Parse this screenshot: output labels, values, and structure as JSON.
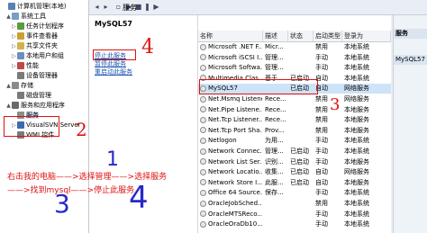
{
  "tree": {
    "items": [
      {
        "label": "计算机管理(本地)",
        "level": 0,
        "expander": "",
        "color": "#5a7fb5"
      },
      {
        "label": "系统工具",
        "level": 1,
        "expander": "▲",
        "color": "#7a9cc9"
      },
      {
        "label": "任务计划程序",
        "level": 2,
        "expander": "▷",
        "color": "#5b9b3e"
      },
      {
        "label": "事件查看器",
        "level": 2,
        "expander": "▷",
        "color": "#c9a036"
      },
      {
        "label": "共享文件夹",
        "level": 2,
        "expander": "▷",
        "color": "#d2b24c"
      },
      {
        "label": "本地用户和组",
        "level": 2,
        "expander": "▷",
        "color": "#6c8ec0"
      },
      {
        "label": "性能",
        "level": 2,
        "expander": "▷",
        "color": "#c04848"
      },
      {
        "label": "设备管理器",
        "level": 2,
        "expander": "",
        "color": "#7a7a7a"
      },
      {
        "label": "存储",
        "level": 1,
        "expander": "▲",
        "color": "#8a8a8a"
      },
      {
        "label": "磁盘管理",
        "level": 2,
        "expander": "",
        "color": "#7a7a7a"
      },
      {
        "label": "服务和应用程序",
        "level": 1,
        "expander": "▲",
        "color": "#6a6a6a"
      },
      {
        "label": "服务",
        "level": 2,
        "expander": "",
        "color": "#8d8d8d"
      },
      {
        "label": "VisualSVN Server",
        "level": 2,
        "expander": "▷",
        "color": "#3a6db0"
      },
      {
        "label": "WMI 控件",
        "level": 2,
        "expander": "",
        "color": "#7a7a7a"
      }
    ]
  },
  "header": {
    "pane_title": "服务",
    "right_pane_title": "服务"
  },
  "detail": {
    "service_name": "MySQL57",
    "links": [
      "停止此服务",
      "暂停此服务",
      "重启动此服务"
    ]
  },
  "list": {
    "columns": [
      "名称",
      "描述",
      "状态",
      "启动类型",
      "登录为"
    ],
    "rows": [
      {
        "name": "Microsoft .NET F...",
        "desc": "Micr...",
        "status": "",
        "startup": "禁用",
        "logon": "本地系统"
      },
      {
        "name": "Microsoft iSCSI I...",
        "desc": "管理...",
        "status": "",
        "startup": "手动",
        "logon": "本地系统"
      },
      {
        "name": "Microsoft Softwa...",
        "desc": "管理...",
        "status": "",
        "startup": "手动",
        "logon": "本地系统"
      },
      {
        "name": "Multimedia Clas...",
        "desc": "基于...",
        "status": "已启动",
        "startup": "自动",
        "logon": "本地系统"
      },
      {
        "name": "MySQL57",
        "desc": "",
        "status": "已启动",
        "startup": "自动",
        "logon": "网络服务"
      },
      {
        "name": "Net.Msmq Listene...",
        "desc": "Rece...",
        "status": "",
        "startup": "禁用",
        "logon": "网络服务"
      },
      {
        "name": "Net.Pipe Listene...",
        "desc": "Rece...",
        "status": "",
        "startup": "禁用",
        "logon": "本地服务"
      },
      {
        "name": "Net.Tcp Listener...",
        "desc": "Rece...",
        "status": "",
        "startup": "禁用",
        "logon": "本地服务"
      },
      {
        "name": "Net.Tcp Port Sha...",
        "desc": "Prov...",
        "status": "",
        "startup": "禁用",
        "logon": "本地服务"
      },
      {
        "name": "Netlogon",
        "desc": "为用...",
        "status": "",
        "startup": "手动",
        "logon": "本地系统"
      },
      {
        "name": "Network Connec...",
        "desc": "管理...",
        "status": "已启动",
        "startup": "手动",
        "logon": "本地系统"
      },
      {
        "name": "Network List Ser...",
        "desc": "识别...",
        "status": "已启动",
        "startup": "手动",
        "logon": "本地服务"
      },
      {
        "name": "Network Locatio...",
        "desc": "收集...",
        "status": "已启动",
        "startup": "自动",
        "logon": "网络服务"
      },
      {
        "name": "Network Store I...",
        "desc": "此服...",
        "status": "已启动",
        "startup": "自动",
        "logon": "本地服务"
      },
      {
        "name": "Office 64 Source...",
        "desc": "保存...",
        "status": "",
        "startup": "手动",
        "logon": "本地系统"
      },
      {
        "name": "OracleJobSched...",
        "desc": "",
        "status": "",
        "startup": "禁用",
        "logon": "本地系统"
      },
      {
        "name": "OracleMTSReco...",
        "desc": "",
        "status": "",
        "startup": "手动",
        "logon": "本地系统"
      },
      {
        "name": "OracleOraDb10...",
        "desc": "",
        "status": "",
        "startup": "手动",
        "logon": "本地系统"
      }
    ]
  },
  "actions": {
    "section1": "服务",
    "item1": "MySQL57"
  },
  "annotations": {
    "n1": "1",
    "n2": "2",
    "n3": "3",
    "n4a": "4",
    "n4b": "4",
    "n3b": "3",
    "line1": "右击我的电脑——>选择管理——>选择服务",
    "line2": "——>找到mysql——>停止此服务"
  }
}
